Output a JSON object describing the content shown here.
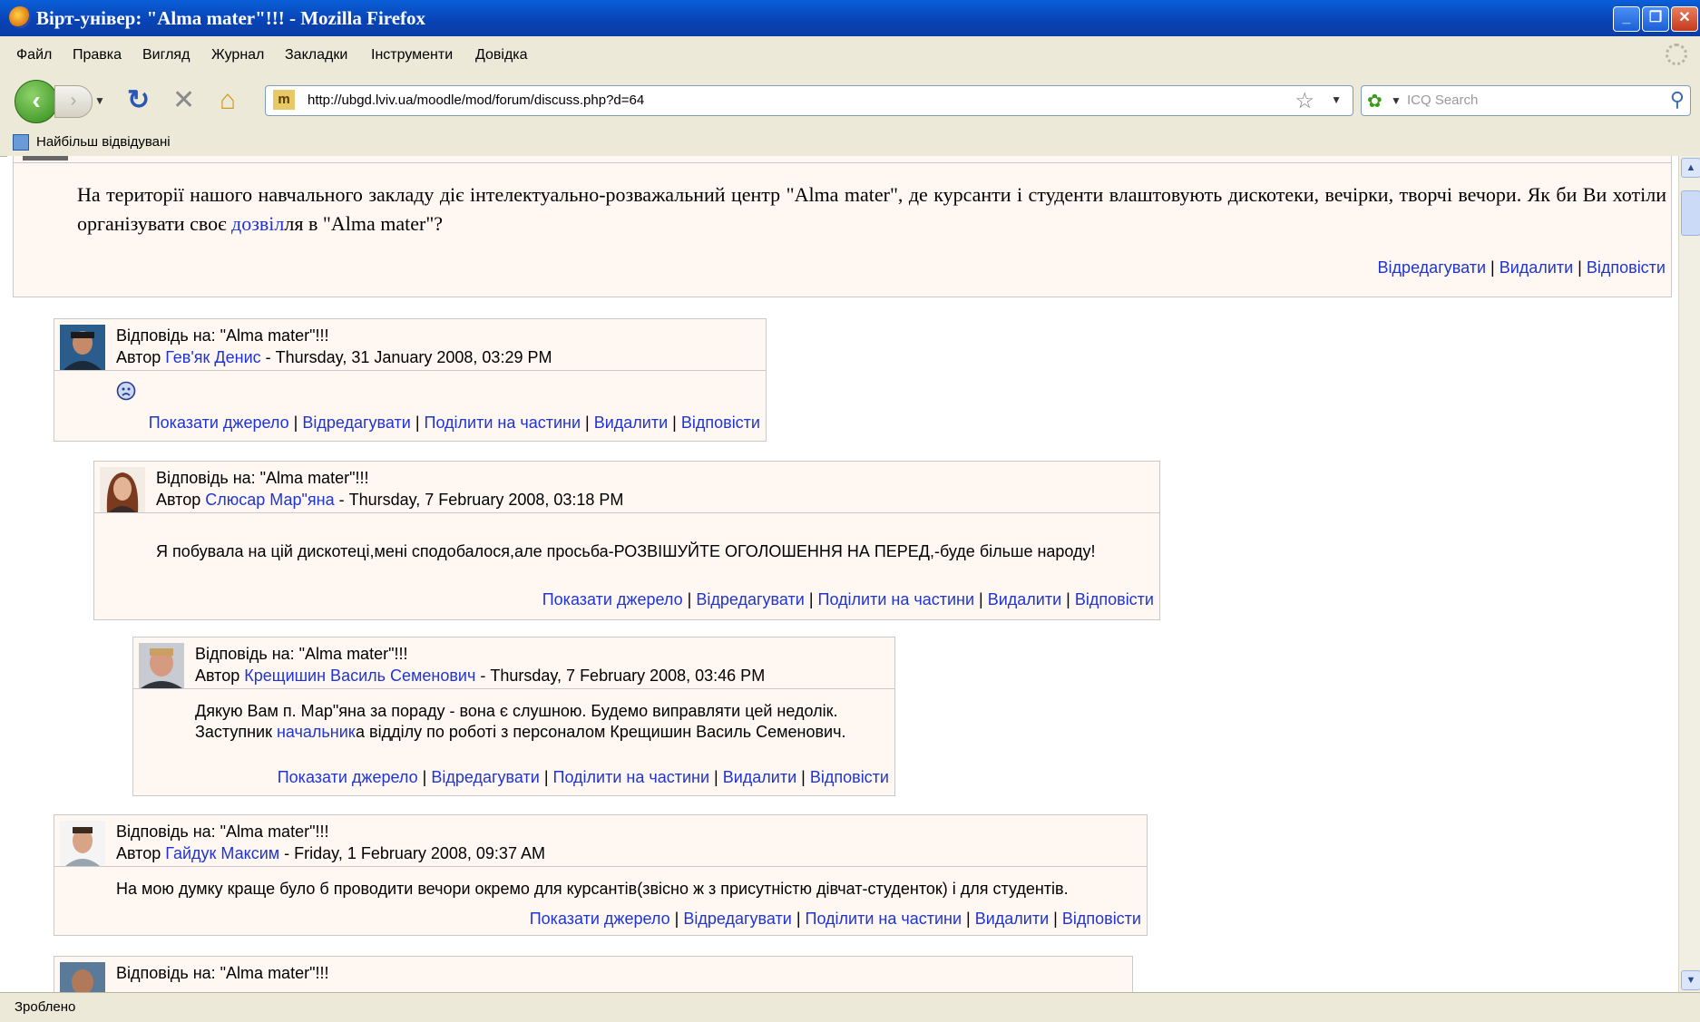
{
  "window": {
    "title": "Вірт-універ: \"Alma mater\"!!! - Mozilla Firefox"
  },
  "menu": [
    "Файл",
    "Правка",
    "Вигляд",
    "Журнал",
    "Закладки",
    "Інструменти",
    "Довідка"
  ],
  "nav": {
    "url": "http://ubgd.lviv.ua/moodle/mod/forum/discuss.php?d=64",
    "search_placeholder": "ICQ Search"
  },
  "bookmarks": {
    "label": "Найбільш відвідувані"
  },
  "status": "Зроблено",
  "main_post": {
    "message_before_link": "На території нашого навчального закладу діє інтелектуально-розважальний центр \"Alma mater\", де курсанти і студенти влаштовують дискотеки, вечірки, творчі вечори. Як би Ви  хотіли організувати своє ",
    "message_link": "дозвіл",
    "message_after_link": "ля в \"Alma mater\"?",
    "commands": [
      "Відредагувати",
      "Видалити",
      "Відповісти"
    ]
  },
  "labels": {
    "author_prefix": "Автор ",
    "separator": " | "
  },
  "posts": [
    {
      "subject": "Відповідь на: \"Alma mater\"!!!",
      "author": "Гев'як Денис",
      "date": " - Thursday, 31 January 2008, 03:29 PM",
      "body_icon": "sad-smiley-icon",
      "commands": [
        "Показати джерело",
        "Відредагувати",
        "Поділити на частини",
        "Видалити",
        "Відповісти"
      ]
    },
    {
      "subject": "Відповідь на: \"Alma mater\"!!!",
      "author": "Слюсар Мар\"яна",
      "date": " - Thursday, 7 February 2008, 03:18 PM",
      "body": "Я побувала на цій дискотеці,мені сподобалося,але просьба-РОЗВІШУЙТЕ ОГОЛОШЕННЯ НА ПЕРЕД,-буде більше народу!",
      "commands": [
        "Показати джерело",
        "Відредагувати",
        "Поділити на частини",
        "Видалити",
        "Відповісти"
      ]
    },
    {
      "subject": "Відповідь на: \"Alma mater\"!!!",
      "author": "Крещишин Василь Семенович",
      "date": " - Thursday, 7 February 2008, 03:46 PM",
      "body_line1": "Дякую Вам п. Мар\"яна за пораду - вона є слушною. Будемо виправляти цей недолік.",
      "body_line2_before": "Заступник ",
      "body_line2_link": "начальник",
      "body_line2_after": "а відділу по роботі з персоналом Крещишин Василь Семенович.",
      "commands": [
        "Показати джерело",
        "Відредагувати",
        "Поділити на частини",
        "Видалити",
        "Відповісти"
      ]
    },
    {
      "subject": "Відповідь на: \"Alma mater\"!!!",
      "author": "Гайдук Максим",
      "date": " - Friday, 1 February 2008, 09:37 AM",
      "body": "На мою  думку краще було б проводити вечори окремо для курсантів(звісно ж з присутністю дівчат-студенток) і для студентів.",
      "commands": [
        "Показати джерело",
        "Відредагувати",
        "Поділити на частини",
        "Видалити",
        "Відповісти"
      ]
    },
    {
      "subject": "Відповідь на: \"Alma mater\"!!!"
    }
  ]
}
